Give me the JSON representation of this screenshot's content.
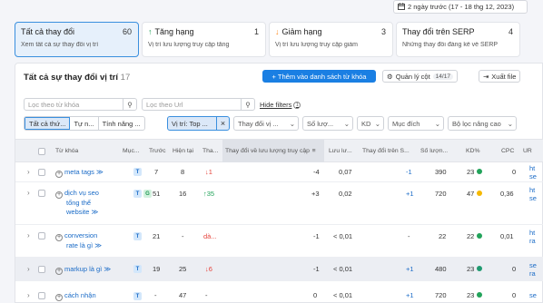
{
  "header": {
    "date_range": "2 ngày trước (17 - 18 thg 12, 2023)"
  },
  "cards": [
    {
      "title": "Tất cả thay đổi",
      "count": "60",
      "sub": "Xem tất cả sự thay đổi vị trí",
      "icon": ""
    },
    {
      "title": "Tăng hạng",
      "count": "1",
      "sub": "Vị trí lưu lượng truy cập tăng",
      "icon": "arrow-up"
    },
    {
      "title": "Giảm hạng",
      "count": "3",
      "sub": "Vị trí lưu lượng truy cập giảm",
      "icon": "arrow-down"
    },
    {
      "title": "Thay đổi trên SERP",
      "count": "4",
      "sub": "Những thay đổi đáng kể về SERP",
      "icon": ""
    }
  ],
  "panel": {
    "title": "Tất cả sự thay đổi vị trí",
    "count": "17",
    "add_button": "Thêm vào danh sách từ khóa",
    "manage_cols": "Quản lý cột",
    "cols_badge": "14/17",
    "export": "Xuất file"
  },
  "filters": {
    "kw_placeholder": "Lọc theo từ khóa",
    "url_placeholder": "Lọc theo Url",
    "hide_filters": "Hide filters",
    "seg": [
      "Tất cả thứ...",
      "Tự n...",
      "Tính năng ..."
    ],
    "chip": "Vị trí: Top ...",
    "dropdowns": [
      "Thay đổi vị ...",
      "Số lượ...",
      "KD",
      "Mục đích",
      "Bộ lọc nâng cao"
    ]
  },
  "columns": [
    "Từ khóa",
    "Mục...",
    "Trước",
    "Hiện tại",
    "Tha...",
    "Thay đổi về lưu lượng truy cập",
    "Lưu lư...",
    "Thay đổi trên S...",
    "Số lượn...",
    "KD%",
    "CPC",
    "UR"
  ],
  "rows": [
    {
      "keyword": [
        "meta tags"
      ],
      "intents": [
        "T"
      ],
      "prev": "7",
      "curr": "8",
      "change": "↓1",
      "change_type": "neg",
      "traffic_change": "-4",
      "traffic": "0,07",
      "serp": "-1",
      "volume": "390",
      "kd": "23",
      "kd_color": "#22a35a",
      "cpc": "0",
      "url": [
        "ht",
        "se"
      ]
    },
    {
      "keyword": [
        "dịch vụ seo",
        "tổng thể",
        "website"
      ],
      "intents": [
        "T",
        "G"
      ],
      "prev": "51",
      "curr": "16",
      "change": "↑35",
      "change_type": "pos",
      "traffic_change": "+3",
      "traffic": "0,02",
      "serp": "+1",
      "volume": "720",
      "kd": "47",
      "kd_color": "#f5b800",
      "cpc": "0,36",
      "url": [
        "ht",
        "se"
      ]
    },
    {
      "keyword": [
        "conversion",
        "rate là gì"
      ],
      "intents": [
        "T"
      ],
      "prev": "21",
      "curr": "-",
      "change": "dà...",
      "change_type": "neg",
      "traffic_change": "-1",
      "traffic": "< 0,01",
      "serp": "-",
      "volume": "22",
      "kd": "22",
      "kd_color": "#22a35a",
      "cpc": "0,01",
      "url": [
        "ht",
        "ra"
      ]
    },
    {
      "keyword": [
        "markup là gì"
      ],
      "intents": [
        "T"
      ],
      "prev": "19",
      "curr": "25",
      "change": "↓6",
      "change_type": "neg",
      "traffic_change": "-1",
      "traffic": "< 0,01",
      "serp": "+1",
      "volume": "480",
      "kd": "23",
      "kd_color": "#1f9a70",
      "cpc": "0",
      "url": [
        "se",
        "ra"
      ]
    },
    {
      "keyword": [
        "cách nhận"
      ],
      "intents": [
        "T"
      ],
      "prev": "-",
      "curr": "47",
      "change": "-",
      "change_type": "neg",
      "traffic_change": "0",
      "traffic": "< 0,01",
      "serp": "+1",
      "volume": "720",
      "kd": "23",
      "kd_color": "#22a35a",
      "cpc": "0",
      "url": [
        "se"
      ]
    }
  ]
}
